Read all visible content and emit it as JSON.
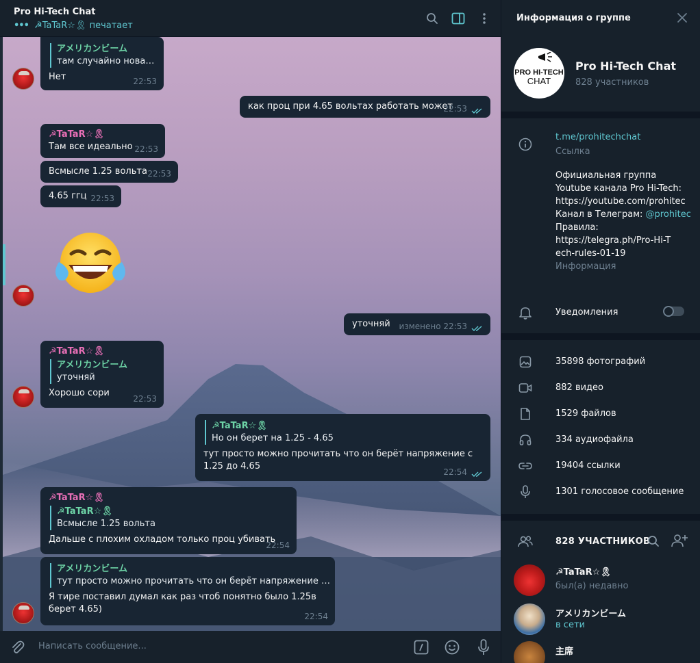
{
  "chat": {
    "title": "Pro Hi-Tech Chat",
    "typing_user": "☭TaTaR☆🎗",
    "typing_text": "печатает",
    "composer_placeholder": "Написать сообщение...",
    "messages": {
      "m1": {
        "reply_name": "アメリカンビーム",
        "reply_text": "там случайно новая ...",
        "text": "Нет",
        "time": "22:53"
      },
      "m2": {
        "text": "как проц при 4.65 вольтах работать может",
        "time": "22:53"
      },
      "m3": {
        "sender": "☭TaTaR☆🎗",
        "text": "Там все идеально",
        "time": "22:53"
      },
      "m4": {
        "text": "Всмысле 1.25 вольта",
        "time": "22:53"
      },
      "m5": {
        "text": "4.65 ггц",
        "time": "22:53"
      },
      "m6": {
        "text": "уточняй",
        "edited": "изменено",
        "time": "22:53"
      },
      "m7": {
        "sender": "☭TaTaR☆🎗",
        "reply_name": "アメリカンビーム",
        "reply_text": "уточняй",
        "text": "Хорошо сори",
        "time": "22:53"
      },
      "m8": {
        "reply_name": "☭TaTaR☆🎗",
        "reply_text": "Но он берет на 1.25 - 4.65",
        "text": "тут просто можно прочитать что он берёт напряжение с 1.25 до 4.65",
        "time": "22:54"
      },
      "m9": {
        "sender": "☭TaTaR☆🎗",
        "reply_name": "☭TaTaR☆🎗",
        "reply_text": "Всмысле 1.25 вольта",
        "text": "Дальше с плохим охладом только проц убивать",
        "time": "22:54"
      },
      "m10": {
        "reply_name": "アメリカンビーム",
        "reply_text": "тут просто можно прочитать что он берёт напряжение с 1.2...",
        "text": "Я тире поставил думал как раз чтоб понятно было 1.25в берет 4.65)",
        "time": "22:54"
      }
    }
  },
  "info": {
    "header_title": "Информация о группе",
    "logo_line1": "PRO HI-TECH",
    "logo_line2": "CHAT",
    "group_name": "Pro Hi-Tech Chat",
    "members_count": "828 участников",
    "link": "t.me/prohitechchat",
    "link_label": "Ссылка",
    "desc_line1": "Официальная группа",
    "desc_line2": "Youtube канала Pro Hi-Tech:",
    "desc_link1": "https://youtube.com/prohitec",
    "desc_line3": "Канал в Телеграм: ",
    "desc_link2": "@prohitec",
    "desc_line4": "Правила:",
    "desc_link3": "https://telegra.ph/Pro-Hi-Tech-rules-01-19",
    "desc_label": "Информация",
    "notifications_label": "Уведомления",
    "stats": {
      "photos": "35898 фотографий",
      "videos": "882 видео",
      "files": "1529 файлов",
      "audio": "334 аудиофайла",
      "links": "19404 ссылки",
      "voice": "1301 голосовое сообщение"
    },
    "members_header": "828 УЧАСТНИКОВ",
    "members": [
      {
        "name": "☭TaTaR☆🎗",
        "status": "был(а) недавно"
      },
      {
        "name": "アメリカンビーム",
        "status": "в сети"
      },
      {
        "name": "主席",
        "status": ""
      }
    ]
  },
  "colors": {
    "accent": "#5fc7d0",
    "panel": "#17212b",
    "bubble": "#182533",
    "sender_pink": "#e86fb6",
    "sender_green": "#6dd3a6"
  }
}
